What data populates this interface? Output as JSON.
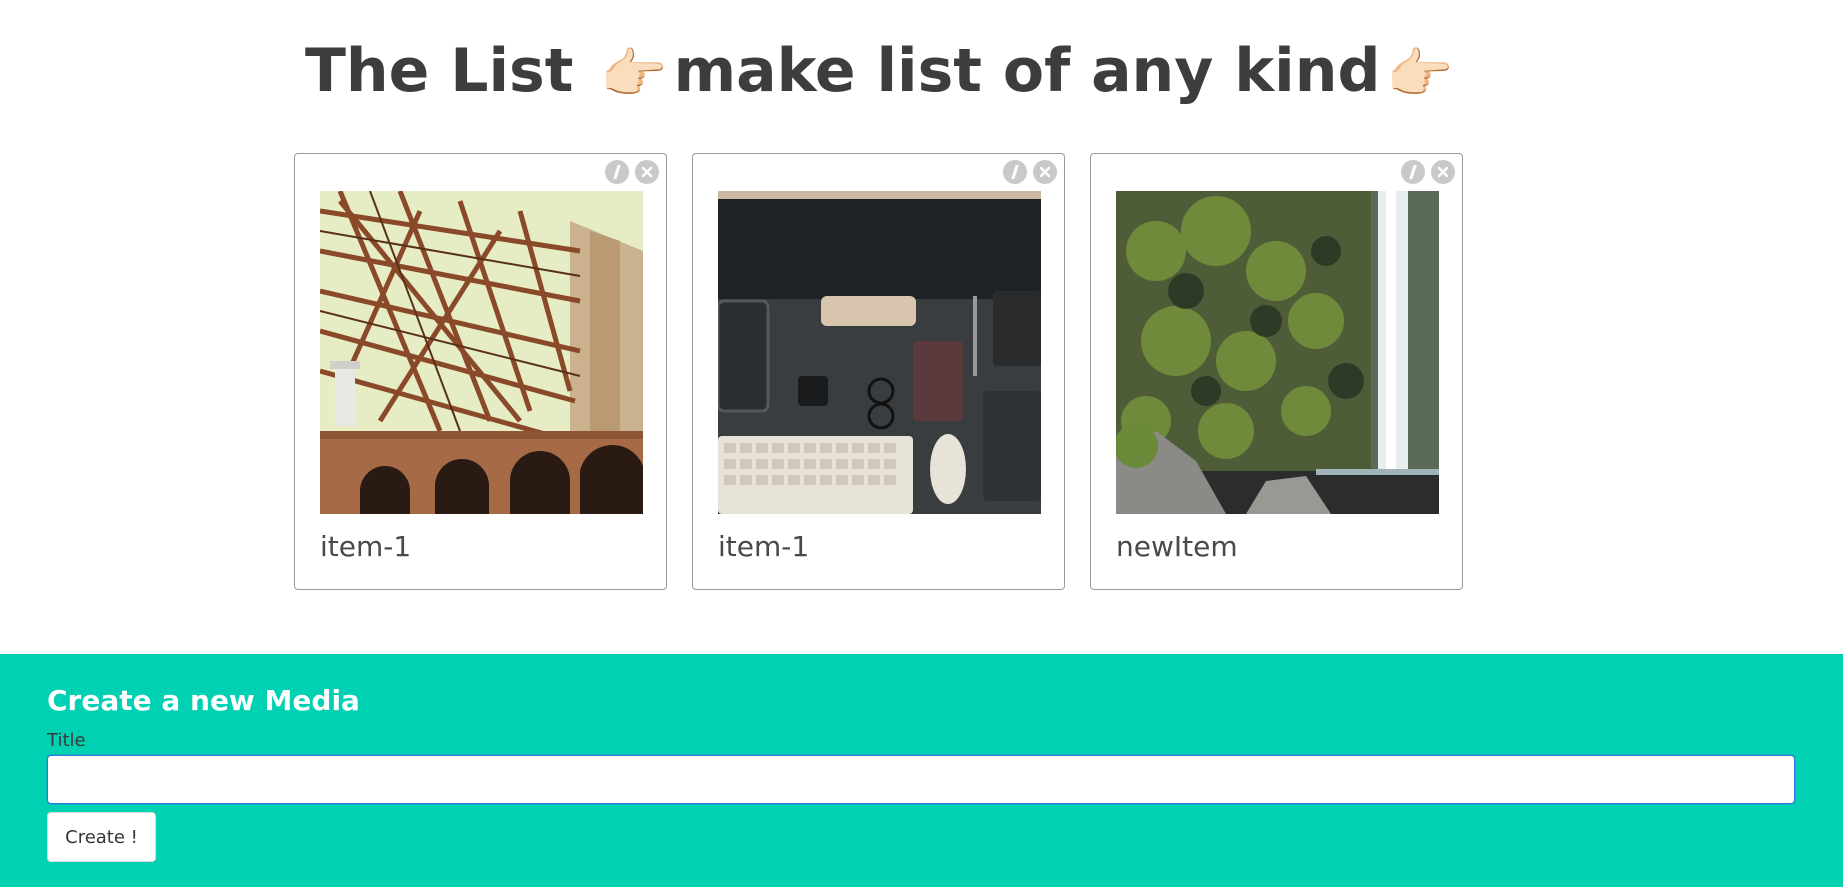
{
  "header": {
    "title_start": "The List",
    "title_end": "make list of any kind",
    "emoji": "👉🏻"
  },
  "cards": [
    {
      "title": "item-1",
      "image": "bridge-steel-arches-photo",
      "edit_icon": "pencil-icon",
      "delete_icon": "close-icon"
    },
    {
      "title": "item-1",
      "image": "desk-keyboard-devices-photo",
      "edit_icon": "pencil-icon",
      "delete_icon": "close-icon"
    },
    {
      "title": "newItem",
      "image": "waterfall-mossy-cliff-photo",
      "edit_icon": "pencil-icon",
      "delete_icon": "close-icon"
    }
  ],
  "create_form": {
    "heading": "Create a new Media",
    "title_label": "Title",
    "title_value": "",
    "submit_label": "Create !"
  },
  "colors": {
    "accent": "#00d1b2",
    "focus_border": "#3273dc",
    "icon_button": "#c9c9c9"
  }
}
